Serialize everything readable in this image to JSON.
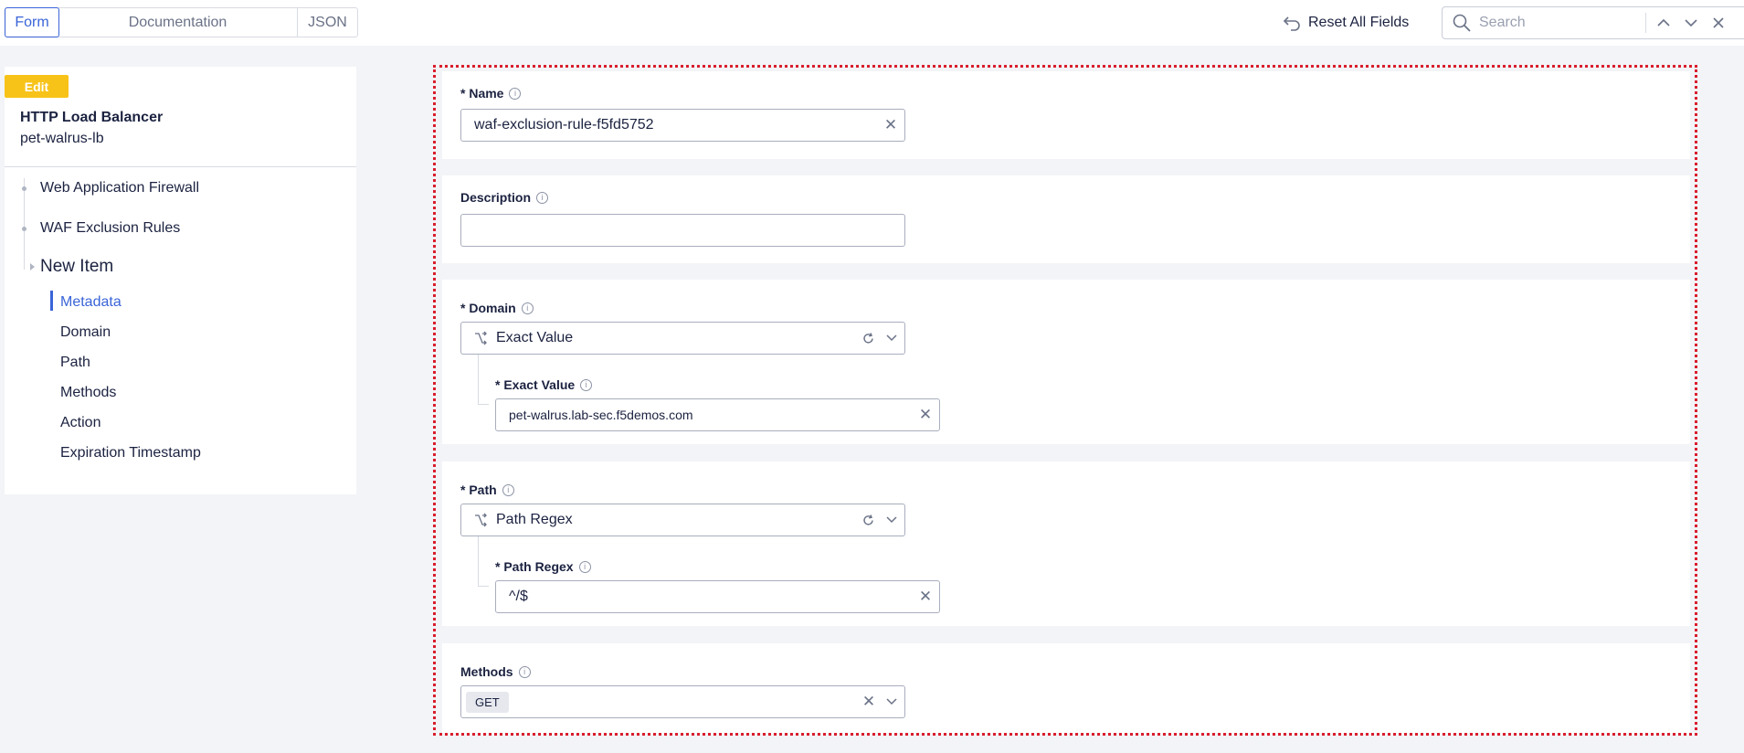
{
  "tabs": [
    {
      "label": "Form",
      "active": true
    },
    {
      "label": "Documentation",
      "active": false
    },
    {
      "label": "JSON",
      "active": false
    }
  ],
  "toolbar": {
    "reset_label": "Reset All Fields",
    "search_placeholder": "Search"
  },
  "sidebar": {
    "edit_badge": "Edit",
    "object_type": "HTTP Load Balancer",
    "object_name": "pet-walrus-lb",
    "breadcrumbs": [
      "Web Application Firewall",
      "WAF Exclusion Rules"
    ],
    "current": "New Item",
    "sections": [
      {
        "label": "Metadata",
        "active": true
      },
      {
        "label": "Domain",
        "active": false
      },
      {
        "label": "Path",
        "active": false
      },
      {
        "label": "Methods",
        "active": false
      },
      {
        "label": "Action",
        "active": false
      },
      {
        "label": "Expiration Timestamp",
        "active": false
      }
    ]
  },
  "form": {
    "name": {
      "label": "* Name",
      "value": "waf-exclusion-rule-f5fd5752"
    },
    "description": {
      "label": "Description",
      "value": ""
    },
    "domain": {
      "label": "* Domain",
      "choice": "Exact Value",
      "nested_label": "* Exact Value",
      "nested_value": "pet-walrus.lab-sec.f5demos.com"
    },
    "path": {
      "label": "* Path",
      "choice": "Path Regex",
      "nested_label": "* Path Regex",
      "nested_value": "^/$"
    },
    "methods": {
      "label": "Methods",
      "tags": [
        "GET"
      ]
    }
  },
  "colors": {
    "accent": "#3a64d8",
    "edit_badge": "#f7c318",
    "highlight_border": "#d91e2e"
  }
}
